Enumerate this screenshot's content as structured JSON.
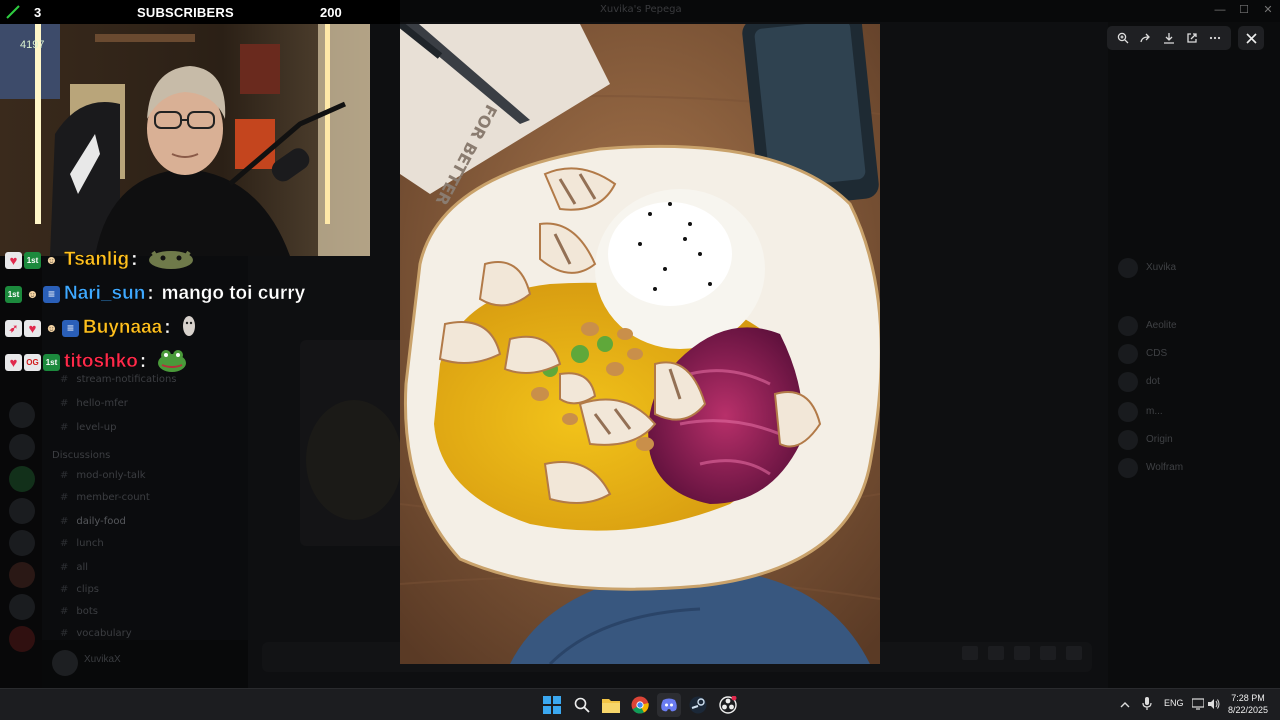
{
  "overlay": {
    "left_count": "3",
    "label": "SUBSCRIBERS",
    "goal": "200",
    "webcam_counter": "4197"
  },
  "chat": [
    {
      "user": "Tsanlig",
      "user_color": "#ffc01e",
      "badges": [
        "heart",
        "first",
        "mask"
      ],
      "message": "",
      "emote": "cat-emote"
    },
    {
      "user": "Nari_sun",
      "user_color": "#3fa9ff",
      "badges": [
        "first",
        "mask",
        "flag"
      ],
      "message": "mango toi curry",
      "emote": ""
    },
    {
      "user": "Buynaaa",
      "user_color": "#ffc01e",
      "badges": [
        "rocket",
        "heart",
        "mask",
        "flag"
      ],
      "message": "",
      "emote": "face-emote"
    },
    {
      "user": "titoshko",
      "user_color": "#ff2a4a",
      "badges": [
        "heart",
        "og",
        "first"
      ],
      "message": "",
      "emote": "frog-emote"
    }
  ],
  "discord": {
    "window_title": "Xuvika's Pepega",
    "channels": [
      "stream-notifications",
      "hello-mfer",
      "level-up",
      "Discussions",
      "mod-only-talk",
      "member-count",
      "daily-food",
      "lunch",
      "all",
      "clips",
      "bots",
      "vocabulary"
    ],
    "members": [
      "Xuvika",
      "Aeolite",
      "CDS",
      "dot",
      "m...",
      "Origin",
      "Wolfram"
    ],
    "user": "XuvikaX"
  },
  "taskbar": {
    "language": "ENG",
    "time": "7:28 PM",
    "date": "8/22/2025"
  },
  "colors": {
    "first_badge": "#1c8a3d",
    "taskbar": "#1c1d20",
    "viewer_toolbar": "#1f2023"
  }
}
